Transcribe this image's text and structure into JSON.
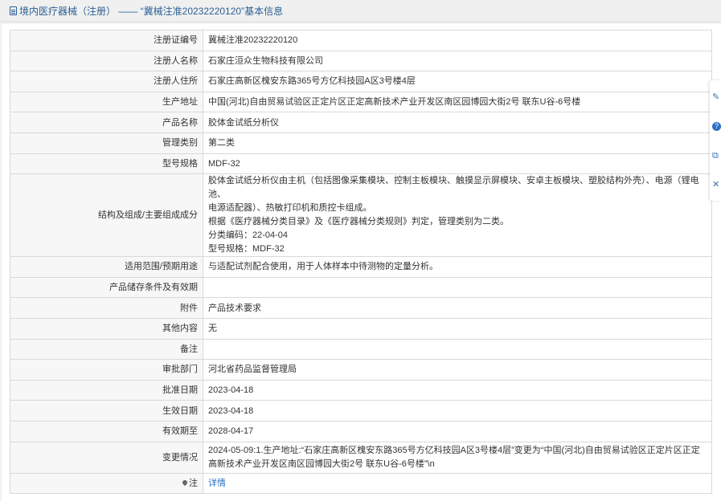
{
  "header": {
    "title": "境内医疗器械（注册） —— “冀械注准20232220120”基本信息"
  },
  "rows": [
    {
      "label": "注册证编号",
      "value": "冀械注准20232220120"
    },
    {
      "label": "注册人名称",
      "value": "石家庄洹众生物科技有限公司"
    },
    {
      "label": "注册人住所",
      "value": "石家庄高新区槐安东路365号方亿科技园A区3号楼4层"
    },
    {
      "label": "生产地址",
      "value": "中国(河北)自由贸易试验区正定片区正定高新技术产业开发区南区园博园大街2号 联东U谷-6号楼"
    },
    {
      "label": "产品名称",
      "value": "胶体金试纸分析仪"
    },
    {
      "label": "管理类别",
      "value": "第二类"
    },
    {
      "label": "型号规格",
      "value": "MDF-32"
    },
    {
      "label": "结构及组成/主要组成成分",
      "lines": [
        "胶体金试纸分析仪由主机（包括图像采集模块、控制主板模块、触摸显示屏模块、安卓主板模块、塑胶结构外壳）、电源（锂电池、",
        "电源适配器）、热敏打印机和质控卡组成。",
        "根据《医疗器械分类目录》及《医疗器械分类规则》判定，管理类别为二类。",
        "分类编码：22-04-04",
        "型号规格：MDF-32"
      ]
    },
    {
      "label": "适用范围/预期用途",
      "value": "与适配试剂配合使用，用于人体样本中待测物的定量分析。"
    },
    {
      "label": "产品储存条件及有效期",
      "value": ""
    },
    {
      "label": "附件",
      "value": "产品技术要求"
    },
    {
      "label": "其他内容",
      "value": "无"
    },
    {
      "label": "备注",
      "value": ""
    },
    {
      "label": "审批部门",
      "value": "河北省药品监督管理局"
    },
    {
      "label": "批准日期",
      "value": "2023-04-18"
    },
    {
      "label": "生效日期",
      "value": "2023-04-18"
    },
    {
      "label": "有效期至",
      "value": "2028-04-17"
    },
    {
      "label": "变更情况",
      "lines": [
        "2024-05-09:1.生产地址:“石家庄高新区槐安东路365号方亿科技园A区3号楼4层”变更为“中国(河北)自由贸易试验区正定片区正定",
        "高新技术产业开发区南区园博园大街2号 联东U谷-6号楼”\\n"
      ]
    },
    {
      "label": "注",
      "value": "详情"
    }
  ],
  "icons": {
    "header": "document-icon",
    "note": "pin-icon",
    "side": [
      "edit-icon",
      "help-icon",
      "copy-icon",
      "close-icon"
    ]
  },
  "side_tools": [
    "✎",
    "?",
    "⧉",
    "✕"
  ]
}
